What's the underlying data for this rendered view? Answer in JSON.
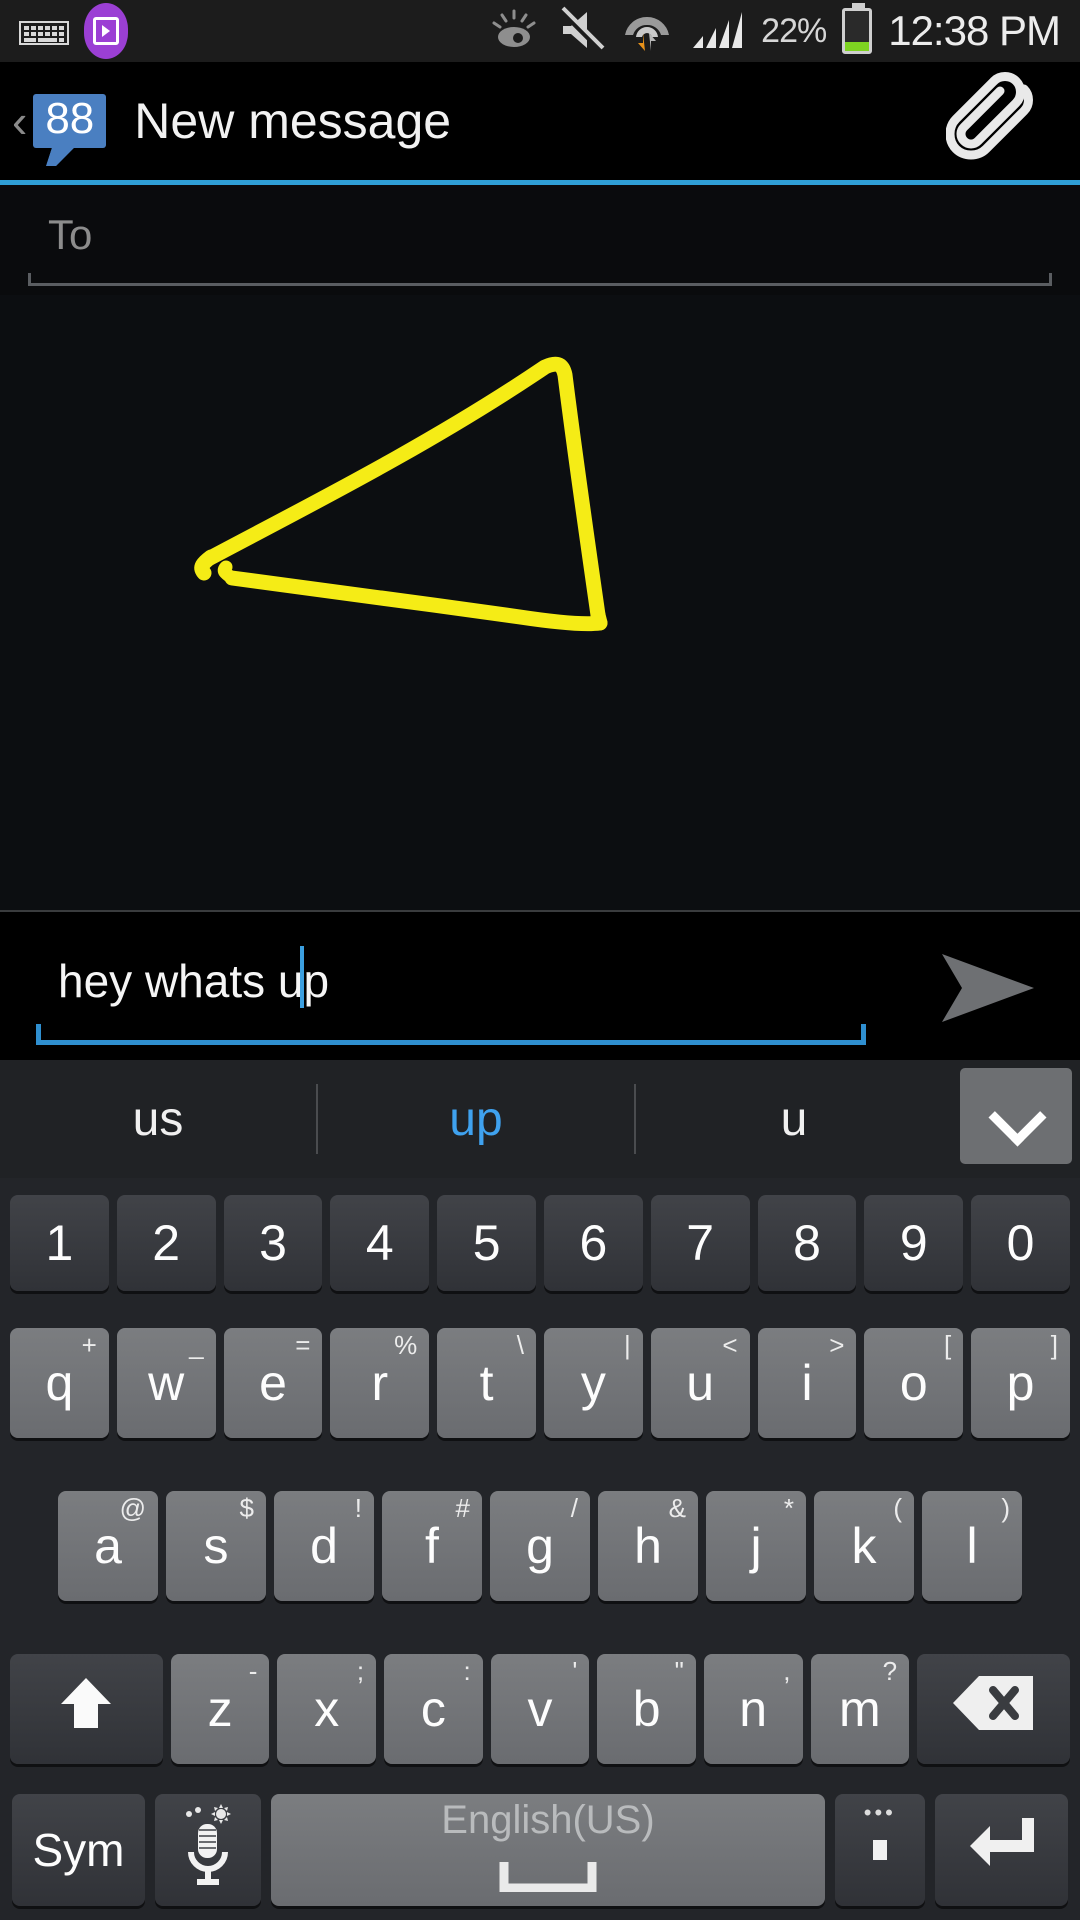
{
  "statusbar": {
    "keyboard_icon": "keyboard-icon",
    "app_icon": "media-app-icon",
    "eye_icon": "smart-stay-eye-icon",
    "mute_icon": "sound-muted-icon",
    "wifi_icon": "wifi-icon",
    "signal_icon": "cellular-signal-icon",
    "battery_percent": "22%",
    "battery_level": 22,
    "clock": "12:38 PM"
  },
  "titlebar": {
    "back_label": "‹",
    "badge_count": "88",
    "title": "New message",
    "attach_label": "attachment"
  },
  "compose": {
    "to_placeholder": "To",
    "to_value": "",
    "message_value": "hey whats up",
    "send_label": "Send",
    "drawing": {
      "description": "yellow hand-drawn triangle",
      "stroke_color": "#f5ec16",
      "stroke_width": 14
    }
  },
  "suggestions": {
    "items": [
      {
        "text": "us",
        "active": false
      },
      {
        "text": "up",
        "active": true
      },
      {
        "text": "u",
        "active": false
      }
    ],
    "expand_label": "expand-suggestions"
  },
  "keyboard": {
    "accent_color": "#3fa2ef",
    "rows": {
      "numbers": [
        {
          "main": "1"
        },
        {
          "main": "2"
        },
        {
          "main": "3"
        },
        {
          "main": "4"
        },
        {
          "main": "5"
        },
        {
          "main": "6"
        },
        {
          "main": "7"
        },
        {
          "main": "8"
        },
        {
          "main": "9"
        },
        {
          "main": "0"
        }
      ],
      "qwerty": [
        {
          "main": "q",
          "alt": "+"
        },
        {
          "main": "w",
          "alt": "_"
        },
        {
          "main": "e",
          "alt": "="
        },
        {
          "main": "r",
          "alt": "%"
        },
        {
          "main": "t",
          "alt": "\\"
        },
        {
          "main": "y",
          "alt": "|"
        },
        {
          "main": "u",
          "alt": "<"
        },
        {
          "main": "i",
          "alt": ">"
        },
        {
          "main": "o",
          "alt": "["
        },
        {
          "main": "p",
          "alt": "]"
        }
      ],
      "asdf": [
        {
          "main": "a",
          "alt": "@"
        },
        {
          "main": "s",
          "alt": "$"
        },
        {
          "main": "d",
          "alt": "!"
        },
        {
          "main": "f",
          "alt": "#"
        },
        {
          "main": "g",
          "alt": "/"
        },
        {
          "main": "h",
          "alt": "&"
        },
        {
          "main": "j",
          "alt": "*"
        },
        {
          "main": "k",
          "alt": "("
        },
        {
          "main": "l",
          "alt": ")"
        }
      ],
      "zxcv": [
        {
          "main": "z",
          "alt": "-"
        },
        {
          "main": "x",
          "alt": ";"
        },
        {
          "main": "c",
          "alt": ":"
        },
        {
          "main": "v",
          "alt": "'"
        },
        {
          "main": "b",
          "alt": "\""
        },
        {
          "main": "n",
          "alt": ","
        },
        {
          "main": "m",
          "alt": "?"
        }
      ]
    },
    "shift_label": "shift",
    "backspace_label": "backspace",
    "sym_label": "Sym",
    "mic_label": "voice-input",
    "space_label": "English(US)",
    "period_label": ".",
    "enter_label": "enter"
  }
}
